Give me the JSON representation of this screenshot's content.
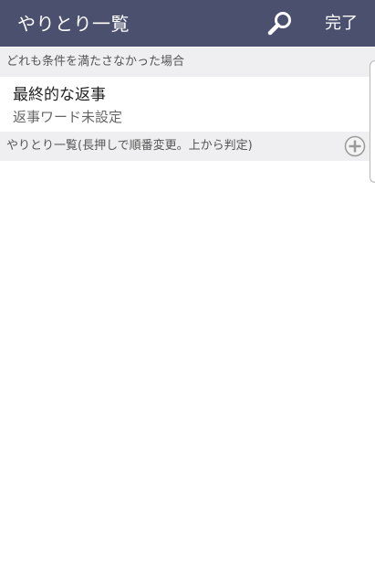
{
  "app_bar": {
    "title": "やりとり一覧",
    "search_icon": "search-icon",
    "done_label": "完了"
  },
  "default_section": {
    "header": "どれも条件を満たさなかった場合"
  },
  "final_reply": {
    "title": "最終的な返事",
    "subtitle": "返事ワード未設定"
  },
  "list_section": {
    "header": "やりとり一覧(長押しで順番変更。上から判定)",
    "add_icon": "plus-circle-icon"
  },
  "colors": {
    "app_bar": "#4b506e",
    "section_bg": "#efeff1"
  }
}
